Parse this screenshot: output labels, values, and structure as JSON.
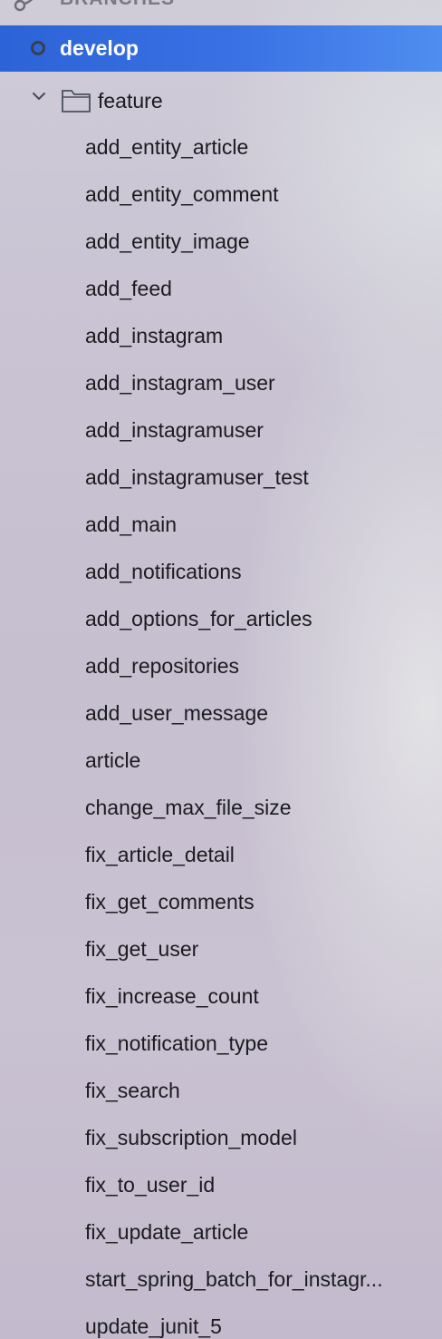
{
  "sidebar": {
    "section_title": "BRANCHES",
    "section_icon": "branch-icon",
    "current_branch": {
      "label": "develop",
      "icon": "head-indicator-icon"
    },
    "folder": {
      "label": "feature",
      "expanded": true,
      "chevron_icon": "chevron-down-icon",
      "folder_icon": "folder-icon"
    },
    "branches": [
      "add_entity_article",
      "add_entity_comment",
      "add_entity_image",
      "add_feed",
      "add_instagram",
      "add_instagram_user",
      "add_instagramuser",
      "add_instagramuser_test",
      "add_main",
      "add_notifications",
      "add_options_for_articles",
      "add_repositories",
      "add_user_message",
      "article",
      "change_max_file_size",
      "fix_article_detail",
      "fix_get_comments",
      "fix_get_user",
      "fix_increase_count",
      "fix_notification_type",
      "fix_search",
      "fix_subscription_model",
      "fix_to_user_id",
      "fix_update_article",
      "start_spring_batch_for_instagr...",
      "update_junit_5"
    ]
  },
  "colors": {
    "selection": "#3a72e4",
    "selected_text": "#ffffff",
    "text": "#1b1b1f",
    "header_text": "#7a7884"
  }
}
